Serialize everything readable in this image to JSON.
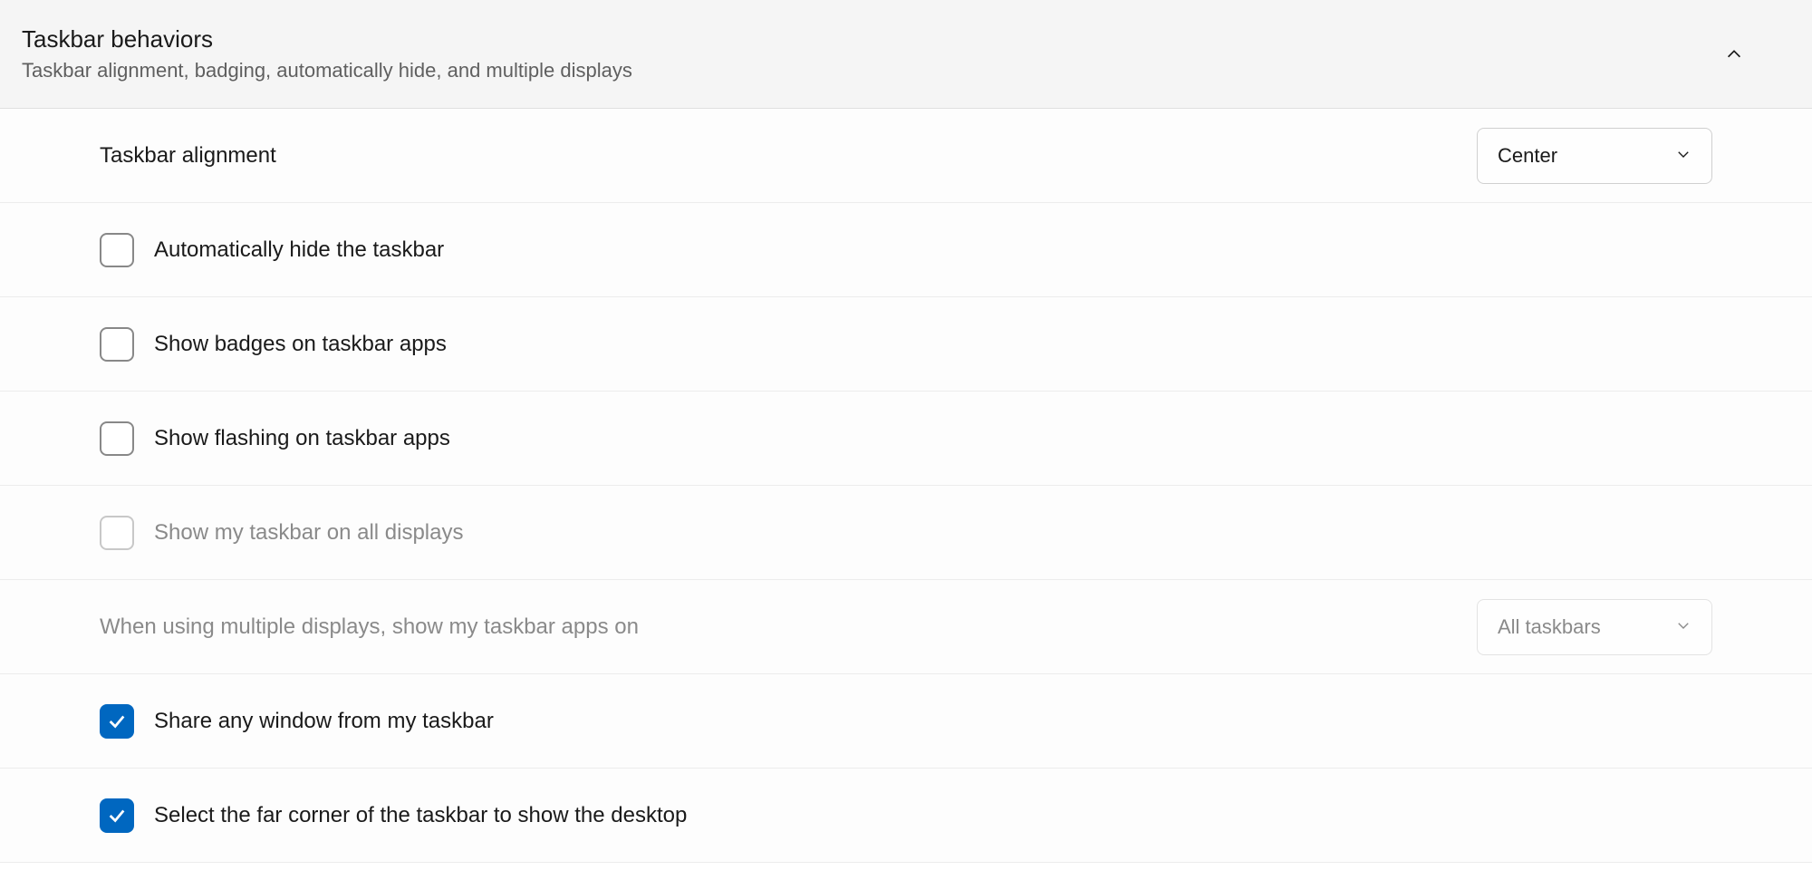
{
  "header": {
    "title": "Taskbar behaviors",
    "subtitle": "Taskbar alignment, badging, automatically hide, and multiple displays"
  },
  "rows": {
    "alignment": {
      "label": "Taskbar alignment",
      "value": "Center"
    },
    "autohide": {
      "label": "Automatically hide the taskbar",
      "checked": false
    },
    "badges": {
      "label": "Show badges on taskbar apps",
      "checked": false
    },
    "flashing": {
      "label": "Show flashing on taskbar apps",
      "checked": false
    },
    "alldisplays": {
      "label": "Show my taskbar on all displays",
      "checked": false,
      "disabled": true
    },
    "multidisplay": {
      "label": "When using multiple displays, show my taskbar apps on",
      "value": "All taskbars",
      "disabled": true
    },
    "sharewindow": {
      "label": "Share any window from my taskbar",
      "checked": true
    },
    "farcorner": {
      "label": "Select the far corner of the taskbar to show the desktop",
      "checked": true
    }
  }
}
